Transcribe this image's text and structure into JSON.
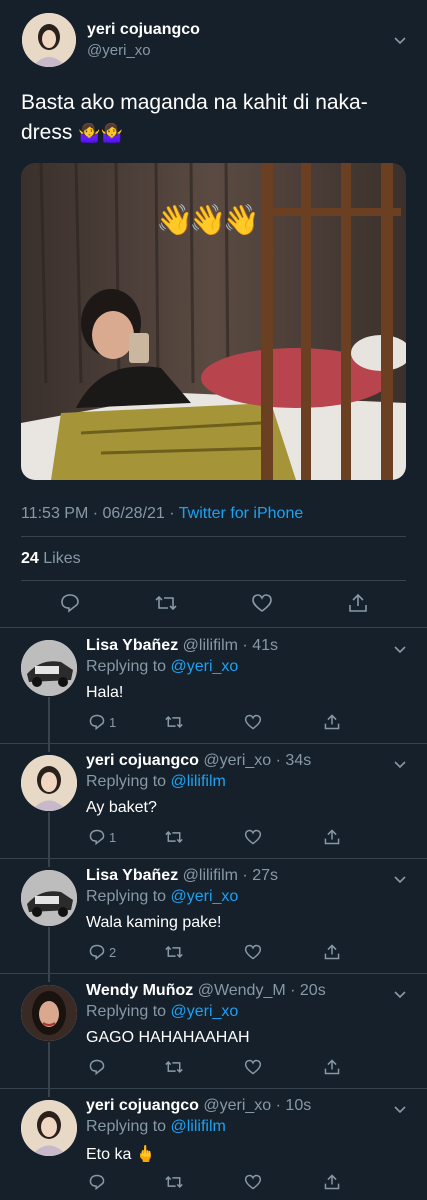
{
  "main_tweet": {
    "display_name": "yeri cojuangco",
    "handle": "@yeri_xo",
    "text_line1": "Basta ako maganda na kahit di naka-",
    "text_line2": "dress",
    "text_emoji": "🤷‍♀️🤷‍♀️",
    "media_overlay_emoji": "👋👋👋",
    "time": "11:53 PM",
    "date": "06/28/21",
    "sep": "·",
    "source": "Twitter for iPhone",
    "likes_count": "24",
    "likes_label": "Likes"
  },
  "replies": [
    {
      "display_name": "Lisa Ybañez",
      "handle_time": "@lilifilm · 41s",
      "replying_prefix": "Replying to",
      "replying_to": "@yeri_xo",
      "text": "Hala!",
      "reply_count": "1",
      "avatar": "car-photo"
    },
    {
      "display_name": "yeri cojuangco",
      "handle_time": "@yeri_xo · 34s",
      "replying_prefix": "Replying to",
      "replying_to": "@lilifilm",
      "text": "Ay baket?",
      "reply_count": "1",
      "avatar": "girl-photo"
    },
    {
      "display_name": "Lisa Ybañez",
      "handle_time": "@lilifilm · 27s",
      "replying_prefix": "Replying to",
      "replying_to": "@yeri_xo",
      "text": "Wala kaming pake!",
      "reply_count": "2",
      "avatar": "car-photo"
    },
    {
      "display_name": "Wendy Muñoz",
      "handle_time": "@Wendy_M · 20s",
      "replying_prefix": "Replying to",
      "replying_to": "@yeri_xo",
      "text": "GAGO HAHAHAAHAH",
      "reply_count": "",
      "avatar": "woman-photo"
    },
    {
      "display_name": "yeri cojuangco",
      "handle_time": "@yeri_xo · 10s",
      "replying_prefix": "Replying to",
      "replying_to": "@lilifilm",
      "text": "Eto ka 🖕",
      "reply_count": "",
      "avatar": "girl-photo"
    }
  ],
  "colors": {
    "background": "#15202b",
    "muted": "#8899a6",
    "link": "#1da1f2",
    "divider": "#38444d"
  }
}
